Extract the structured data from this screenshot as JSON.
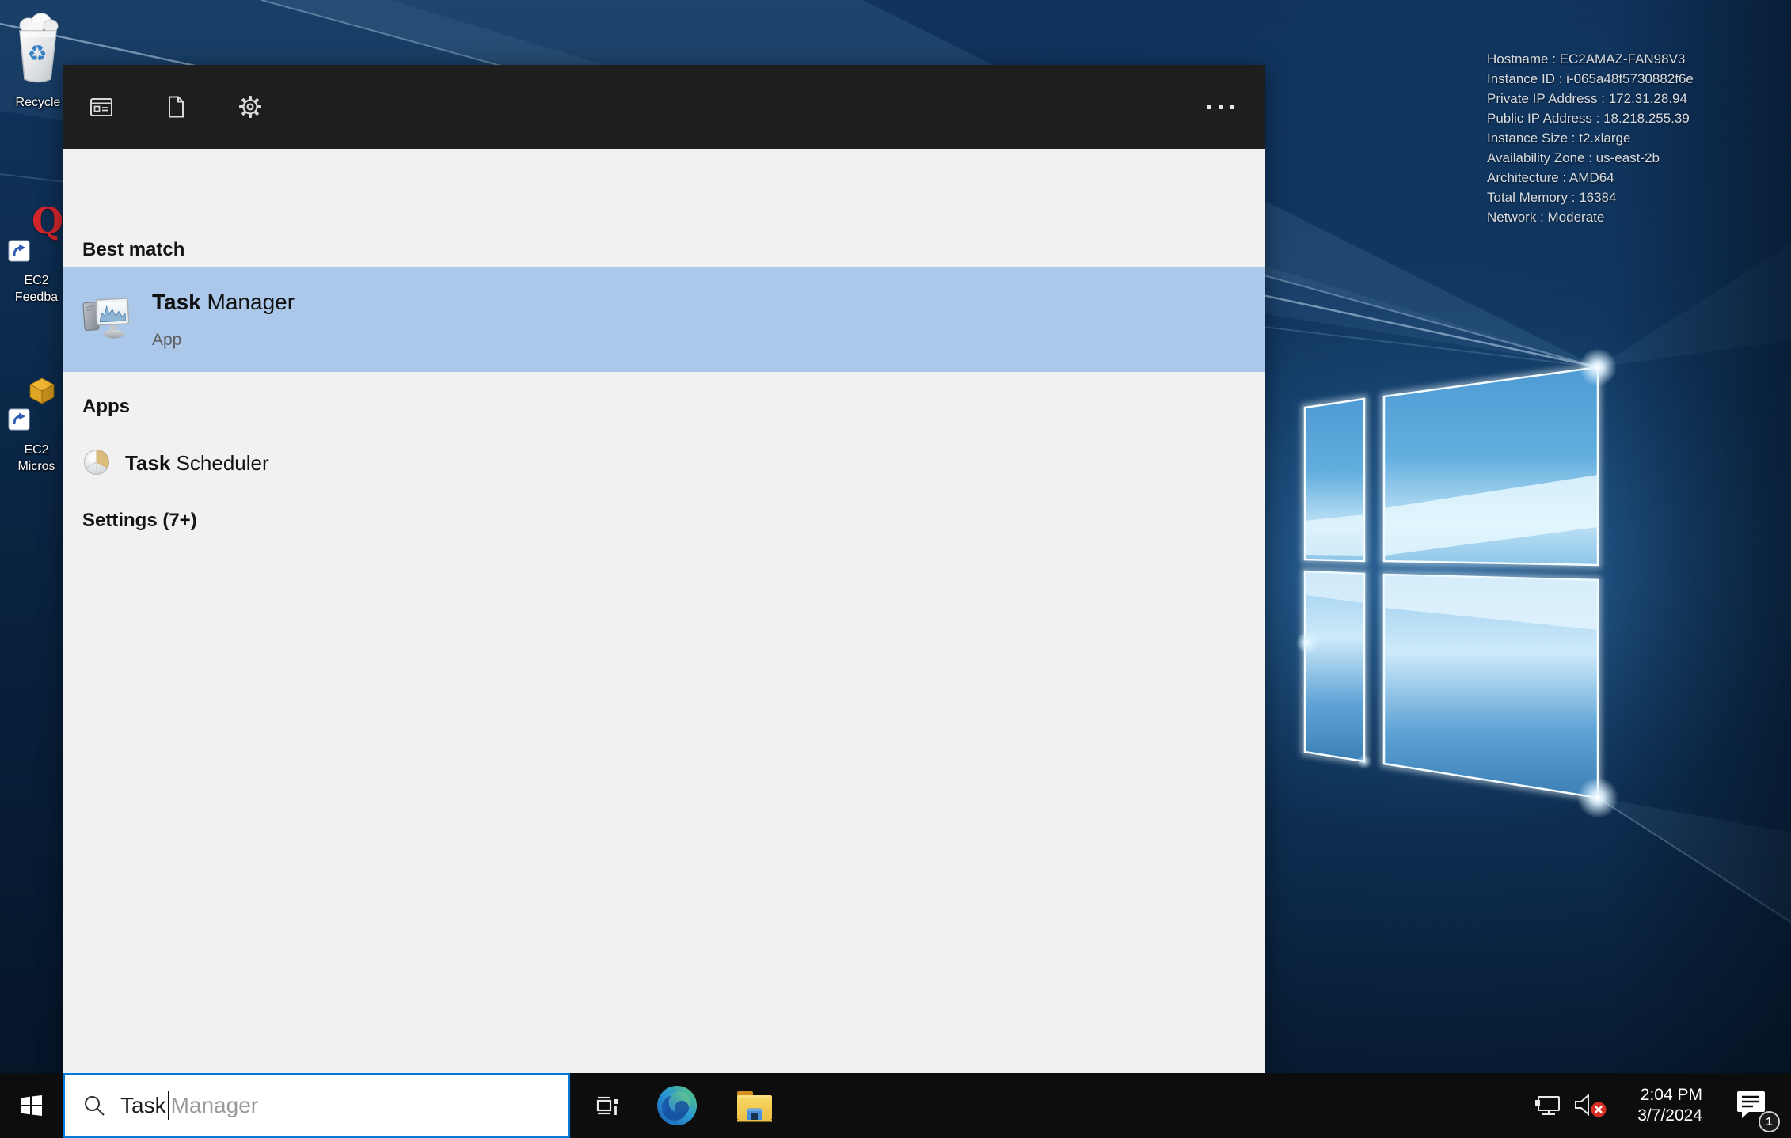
{
  "ec2_info": {
    "lines": [
      "Hostname : EC2AMAZ-FAN98V3",
      "Instance ID : i-065a48f5730882f6e",
      "Private IP Address : 172.31.28.94",
      "Public IP Address : 18.218.255.39",
      "Instance Size : t2.xlarge",
      "Availability Zone : us-east-2b",
      "Architecture : AMD64",
      "Total Memory : 16384",
      "Network : Moderate"
    ]
  },
  "desktop_icons": {
    "recycle_bin_label": "Recycle",
    "ec2_feedback_glyph": "Q",
    "ec2_feedback_label_line1": "EC2",
    "ec2_feedback_label_line2": "Feedba",
    "ec2_microsoft_label_line1": "EC2",
    "ec2_microsoft_label_line2": "Micros"
  },
  "search_panel": {
    "best_match_header": "Best match",
    "best_match": {
      "title_match": "Task",
      "title_rest": " Manager",
      "subtitle": "App"
    },
    "apps_header": "Apps",
    "apps": [
      {
        "title_match": "Task",
        "title_rest": " Scheduler"
      }
    ],
    "settings_header": "Settings (7+)"
  },
  "taskbar": {
    "search": {
      "typed": "Task",
      "suggestion": "Manager"
    },
    "tray": {
      "time": "2:04 PM",
      "date": "3/7/2024",
      "notification_count": "1"
    }
  },
  "colors": {
    "accent": "#0078d7",
    "highlight_row": "#abc8ea",
    "panel_header": "#1e1e1e",
    "panel_body": "#f1f1f1",
    "taskbar": "#0d0d0d"
  },
  "icons": {
    "apps-filter-icon": "app window with list lines",
    "documents-filter-icon": "document page with folded corner",
    "settings-filter-icon": "gear outline",
    "more-icon": "horizontal ellipsis",
    "task-manager-icon": "monitor with performance graph and pc tower",
    "task-scheduler-icon": "pie-clock sphere with tan wedge",
    "recycle-bin-icon": "white bin with blue recycle symbol",
    "ec2-feedback-icon": "red Q letter shortcut",
    "ec2-microsoft-icon": "gold cube shortcut",
    "shortcut-arrow-icon": "white square with blue up-right arrow",
    "start-icon": "white windows flag",
    "search-icon": "magnifier",
    "task-view-icon": "film strip rectangles",
    "edge-icon": "blue-green swirl circle",
    "file-explorer-icon": "yellow folder with blue front",
    "network-icon": "monitor with ethernet plug",
    "volume-muted-icon": "speaker with red x",
    "action-center-icon": "chat bubble with lines"
  }
}
